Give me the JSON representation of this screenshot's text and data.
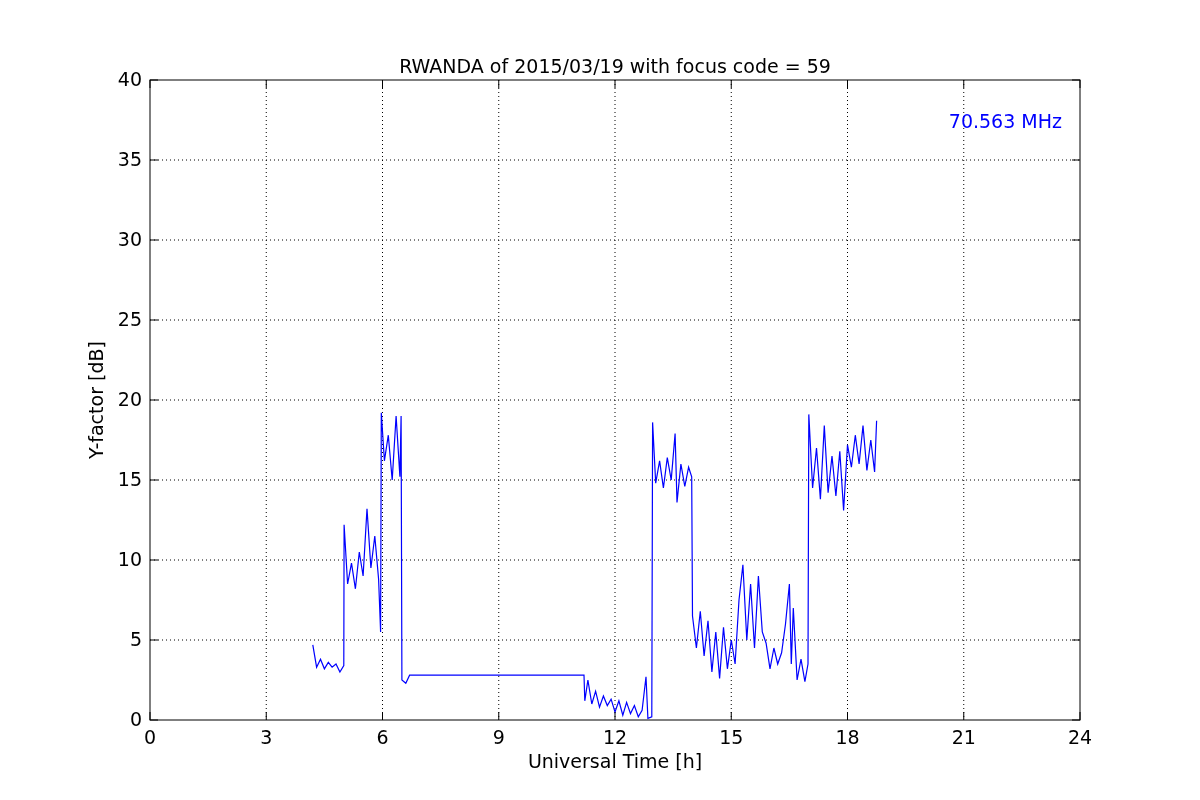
{
  "chart_data": {
    "type": "line",
    "title": "RWANDA of 2015/03/19 with focus code = 59",
    "xlabel": "Universal Time [h]",
    "ylabel": "Y-factor [dB]",
    "xlim": [
      0,
      24
    ],
    "ylim": [
      0,
      40
    ],
    "xticks": [
      0,
      3,
      6,
      9,
      12,
      15,
      18,
      21,
      24
    ],
    "yticks": [
      0,
      5,
      10,
      15,
      20,
      25,
      30,
      35,
      40
    ],
    "x": [
      4.2,
      4.3,
      4.4,
      4.5,
      4.6,
      4.7,
      4.8,
      4.9,
      5.0,
      5.01,
      5.1,
      5.2,
      5.3,
      5.4,
      5.5,
      5.6,
      5.7,
      5.8,
      5.9,
      5.95,
      5.97,
      6.05,
      6.15,
      6.25,
      6.35,
      6.45,
      6.48,
      6.5,
      6.6,
      6.7,
      11.2,
      11.22,
      11.3,
      11.4,
      11.5,
      11.6,
      11.7,
      11.8,
      11.9,
      12.0,
      12.1,
      12.2,
      12.3,
      12.4,
      12.5,
      12.6,
      12.7,
      12.8,
      12.85,
      12.95,
      12.97,
      13.05,
      13.15,
      13.25,
      13.35,
      13.45,
      13.55,
      13.6,
      13.7,
      13.8,
      13.9,
      13.98,
      14.0,
      14.1,
      14.2,
      14.3,
      14.4,
      14.5,
      14.6,
      14.7,
      14.8,
      14.9,
      15.0,
      15.1,
      15.2,
      15.3,
      15.4,
      15.5,
      15.6,
      15.7,
      15.8,
      15.9,
      16.0,
      16.1,
      16.2,
      16.3,
      16.4,
      16.5,
      16.55,
      16.6,
      16.7,
      16.8,
      16.9,
      16.98,
      17.0,
      17.1,
      17.2,
      17.3,
      17.4,
      17.5,
      17.6,
      17.7,
      17.8,
      17.9,
      18.0,
      18.1,
      18.2,
      18.3,
      18.4,
      18.5,
      18.6,
      18.7,
      18.75
    ],
    "series": [
      {
        "color": "#0000ff",
        "values": [
          4.7,
          3.3,
          3.8,
          3.2,
          3.6,
          3.3,
          3.5,
          3.0,
          3.4,
          12.2,
          8.5,
          9.8,
          8.2,
          10.5,
          9.0,
          13.2,
          9.5,
          11.5,
          8.8,
          5.5,
          19.2,
          16.2,
          17.8,
          15.0,
          19.0,
          15.2,
          19.0,
          2.5,
          2.3,
          2.8,
          2.8,
          1.2,
          2.5,
          1.0,
          1.8,
          0.8,
          1.5,
          0.9,
          1.3,
          0.5,
          1.2,
          0.3,
          1.1,
          0.4,
          0.9,
          0.2,
          0.6,
          2.7,
          0.1,
          0.2,
          18.6,
          14.8,
          16.2,
          14.5,
          16.4,
          15.0,
          17.9,
          13.6,
          16.0,
          14.6,
          15.8,
          15.2,
          6.5,
          4.5,
          6.8,
          4.0,
          6.2,
          3.0,
          5.5,
          2.6,
          5.8,
          3.2,
          5.0,
          3.5,
          7.5,
          9.7,
          5.0,
          8.5,
          4.5,
          9.0,
          5.5,
          4.8,
          3.2,
          4.5,
          3.5,
          4.2,
          6.0,
          8.5,
          3.5,
          7.0,
          2.5,
          3.8,
          2.4,
          3.5,
          19.1,
          14.5,
          17.0,
          13.8,
          18.4,
          14.2,
          16.5,
          14.0,
          16.8,
          13.1,
          17.2,
          15.8,
          17.8,
          16.0,
          18.4,
          15.6,
          17.5,
          15.5,
          18.7
        ]
      }
    ],
    "annotations": [
      "70.563 MHz"
    ],
    "grid": true
  }
}
